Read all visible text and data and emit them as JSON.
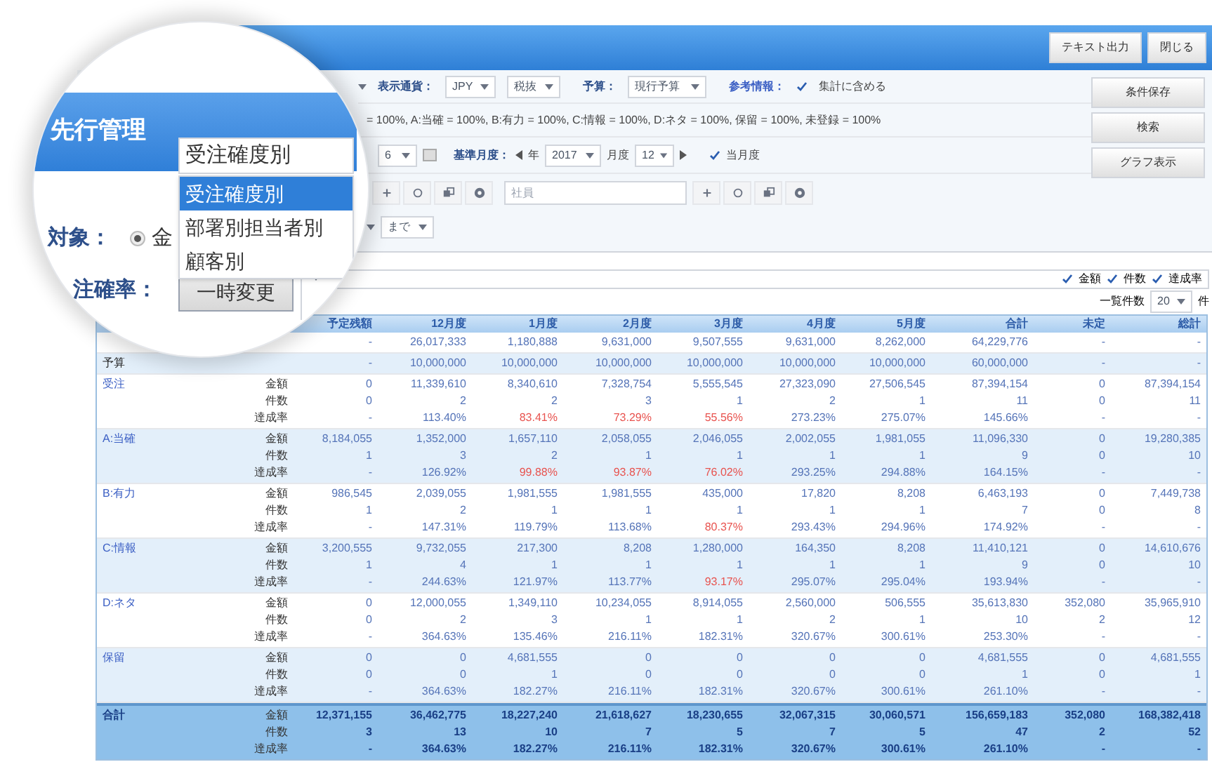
{
  "header": {
    "buttons": [
      "テキスト出力",
      "閉じる"
    ]
  },
  "magnifier": {
    "title": "先行管理",
    "view_select": {
      "value": "受注確度別",
      "options": [
        {
          "label": "受注確度別",
          "selected": true
        },
        {
          "label": "部署別担当者別",
          "selected": false
        },
        {
          "label": "顧客別",
          "selected": false
        }
      ]
    },
    "target_label": "対象：",
    "target_radio": {
      "label": "金",
      "selected": true
    },
    "rate_label": "注確率：",
    "temp_button": "一時変更"
  },
  "filters": {
    "currency": {
      "label": "表示通貨：",
      "value": "JPY"
    },
    "tax": {
      "value": "税抜"
    },
    "budget": {
      "label": "予算：",
      "value": "現行予算"
    },
    "reference": {
      "label": "参考情報：",
      "checkbox": {
        "label": "集計に含める",
        "checked": true
      }
    },
    "rates_text": "= 100%, A:当確 = 100%, B:有力 = 100%, C:情報 = 100%, D:ネタ = 100%, 保留 = 100%, 未登録 = 100%",
    "months": {
      "value": "6"
    },
    "base_month": {
      "label": "基準月度：",
      "year_label": "年",
      "year": "2017",
      "month_label": "月度",
      "month": "12"
    },
    "current_month": {
      "label": "当月度",
      "checked": true
    },
    "employee_placeholder": "社員",
    "until": "まで"
  },
  "side_buttons": [
    "条件保存",
    "検索",
    "グラフ表示"
  ],
  "display_checks": [
    {
      "label": "金額",
      "checked": true
    },
    {
      "label": "件数",
      "checked": true
    },
    {
      "label": "達成率",
      "checked": true
    }
  ],
  "page_size": {
    "label": "一覧件数",
    "value": "20",
    "unit": "件"
  },
  "table": {
    "columns": [
      "予定残額",
      "12月度",
      "1月度",
      "2月度",
      "3月度",
      "4月度",
      "5月度",
      "合計",
      "未定",
      "総計"
    ],
    "rows": [
      {
        "kind": "single",
        "cells": [
          "-",
          "26,017,333",
          "1,180,888",
          "9,631,000",
          "9,507,555",
          "9,631,000",
          "8,262,000",
          "64,229,776",
          "-",
          "-"
        ]
      },
      {
        "kind": "single",
        "label": "予算",
        "cells": [
          "-",
          "10,000,000",
          "10,000,000",
          "10,000,000",
          "10,000,000",
          "10,000,000",
          "10,000,000",
          "60,000,000",
          "-",
          "-"
        ]
      },
      {
        "kind": "group",
        "label": "受注",
        "lines": [
          {
            "label": "金額",
            "cells": [
              "0",
              "11,339,610",
              "8,340,610",
              "7,328,754",
              "5,555,545",
              "27,323,090",
              "27,506,545",
              "87,394,154",
              "0",
              "87,394,154"
            ]
          },
          {
            "label": "件数",
            "cells": [
              "0",
              "2",
              "2",
              "3",
              "1",
              "2",
              "1",
              "11",
              "0",
              "11"
            ]
          },
          {
            "label": "達成率",
            "cells": [
              {
                "text": "-",
                "below": false
              },
              {
                "text": "113.40%",
                "below": false
              },
              {
                "text": "83.41%",
                "below": true
              },
              {
                "text": "73.29%",
                "below": true
              },
              {
                "text": "55.56%",
                "below": true
              },
              {
                "text": "273.23%",
                "below": false
              },
              {
                "text": "275.07%",
                "below": false
              },
              {
                "text": "145.66%",
                "below": false
              },
              {
                "text": "-",
                "below": false
              },
              {
                "text": "-",
                "below": false
              }
            ]
          }
        ]
      },
      {
        "kind": "group",
        "label": "A:当確",
        "lines": [
          {
            "label": "金額",
            "cells": [
              "8,184,055",
              "1,352,000",
              "1,657,110",
              "2,058,055",
              "2,046,055",
              "2,002,055",
              "1,981,055",
              "11,096,330",
              "0",
              "19,280,385"
            ]
          },
          {
            "label": "件数",
            "cells": [
              "1",
              "3",
              "2",
              "1",
              "1",
              "1",
              "1",
              "9",
              "0",
              "10"
            ]
          },
          {
            "label": "達成率",
            "cells": [
              {
                "text": "-",
                "below": false
              },
              {
                "text": "126.92%",
                "below": false
              },
              {
                "text": "99.88%",
                "below": true
              },
              {
                "text": "93.87%",
                "below": true
              },
              {
                "text": "76.02%",
                "below": true
              },
              {
                "text": "293.25%",
                "below": false
              },
              {
                "text": "294.88%",
                "below": false
              },
              {
                "text": "164.15%",
                "below": false
              },
              {
                "text": "-",
                "below": false
              },
              {
                "text": "-",
                "below": false
              }
            ]
          }
        ]
      },
      {
        "kind": "group",
        "label": "B:有力",
        "lines": [
          {
            "label": "金額",
            "cells": [
              "986,545",
              "2,039,055",
              "1,981,555",
              "1,981,555",
              "435,000",
              "17,820",
              "8,208",
              "6,463,193",
              "0",
              "7,449,738"
            ]
          },
          {
            "label": "件数",
            "cells": [
              "1",
              "2",
              "1",
              "1",
              "1",
              "1",
              "1",
              "7",
              "0",
              "8"
            ]
          },
          {
            "label": "達成率",
            "cells": [
              {
                "text": "-",
                "below": false
              },
              {
                "text": "147.31%",
                "below": false
              },
              {
                "text": "119.79%",
                "below": false
              },
              {
                "text": "113.68%",
                "below": false
              },
              {
                "text": "80.37%",
                "below": true
              },
              {
                "text": "293.43%",
                "below": false
              },
              {
                "text": "294.96%",
                "below": false
              },
              {
                "text": "174.92%",
                "below": false
              },
              {
                "text": "-",
                "below": false
              },
              {
                "text": "-",
                "below": false
              }
            ]
          }
        ]
      },
      {
        "kind": "group",
        "label": "C:情報",
        "lines": [
          {
            "label": "金額",
            "cells": [
              "3,200,555",
              "9,732,055",
              "217,300",
              "8,208",
              "1,280,000",
              "164,350",
              "8,208",
              "11,410,121",
              "0",
              "14,610,676"
            ]
          },
          {
            "label": "件数",
            "cells": [
              "1",
              "4",
              "1",
              "1",
              "1",
              "1",
              "1",
              "9",
              "0",
              "10"
            ]
          },
          {
            "label": "達成率",
            "cells": [
              {
                "text": "-",
                "below": false
              },
              {
                "text": "244.63%",
                "below": false
              },
              {
                "text": "121.97%",
                "below": false
              },
              {
                "text": "113.77%",
                "below": false
              },
              {
                "text": "93.17%",
                "below": true
              },
              {
                "text": "295.07%",
                "below": false
              },
              {
                "text": "295.04%",
                "below": false
              },
              {
                "text": "193.94%",
                "below": false
              },
              {
                "text": "-",
                "below": false
              },
              {
                "text": "-",
                "below": false
              }
            ]
          }
        ]
      },
      {
        "kind": "group",
        "label": "D:ネタ",
        "lines": [
          {
            "label": "金額",
            "cells": [
              "0",
              "12,000,055",
              "1,349,110",
              "10,234,055",
              "8,914,055",
              "2,560,000",
              "506,555",
              "35,613,830",
              "352,080",
              "35,965,910"
            ]
          },
          {
            "label": "件数",
            "cells": [
              "0",
              "2",
              "3",
              "1",
              "1",
              "2",
              "1",
              "10",
              "2",
              "12"
            ]
          },
          {
            "label": "達成率",
            "cells": [
              {
                "text": "-",
                "below": false
              },
              {
                "text": "364.63%",
                "below": false
              },
              {
                "text": "135.46%",
                "below": false
              },
              {
                "text": "216.11%",
                "below": false
              },
              {
                "text": "182.31%",
                "below": false
              },
              {
                "text": "320.67%",
                "below": false
              },
              {
                "text": "300.61%",
                "below": false
              },
              {
                "text": "253.30%",
                "below": false
              },
              {
                "text": "-",
                "below": false
              },
              {
                "text": "-",
                "below": false
              }
            ]
          }
        ]
      },
      {
        "kind": "group",
        "label": "保留",
        "lines": [
          {
            "label": "金額",
            "cells": [
              "0",
              "0",
              "4,681,555",
              "0",
              "0",
              "0",
              "0",
              "4,681,555",
              "0",
              "4,681,555"
            ]
          },
          {
            "label": "件数",
            "cells": [
              "0",
              "0",
              "1",
              "0",
              "0",
              "0",
              "0",
              "1",
              "0",
              "1"
            ]
          },
          {
            "label": "達成率",
            "cells": [
              {
                "text": "-",
                "below": false
              },
              {
                "text": "364.63%",
                "below": false
              },
              {
                "text": "182.27%",
                "below": false
              },
              {
                "text": "216.11%",
                "below": false
              },
              {
                "text": "182.31%",
                "below": false
              },
              {
                "text": "320.67%",
                "below": false
              },
              {
                "text": "300.61%",
                "below": false
              },
              {
                "text": "261.10%",
                "below": false
              },
              {
                "text": "-",
                "below": false
              },
              {
                "text": "-",
                "below": false
              }
            ]
          }
        ]
      },
      {
        "kind": "total",
        "label": "合計",
        "lines": [
          {
            "label": "金額",
            "cells": [
              "12,371,155",
              "36,462,775",
              "18,227,240",
              "21,618,627",
              "18,230,655",
              "32,067,315",
              "30,060,571",
              "156,659,183",
              "352,080",
              "168,382,418"
            ]
          },
          {
            "label": "件数",
            "cells": [
              "3",
              "13",
              "10",
              "7",
              "5",
              "7",
              "5",
              "47",
              "2",
              "52"
            ]
          },
          {
            "label": "達成率",
            "cells": [
              {
                "text": "-",
                "below": false
              },
              {
                "text": "364.63%",
                "below": false
              },
              {
                "text": "182.27%",
                "below": false
              },
              {
                "text": "216.11%",
                "below": false
              },
              {
                "text": "182.31%",
                "below": false
              },
              {
                "text": "320.67%",
                "below": false
              },
              {
                "text": "300.61%",
                "below": false
              },
              {
                "text": "261.10%",
                "below": false
              },
              {
                "text": "-",
                "below": false
              },
              {
                "text": "-",
                "below": false
              }
            ]
          }
        ]
      }
    ]
  }
}
